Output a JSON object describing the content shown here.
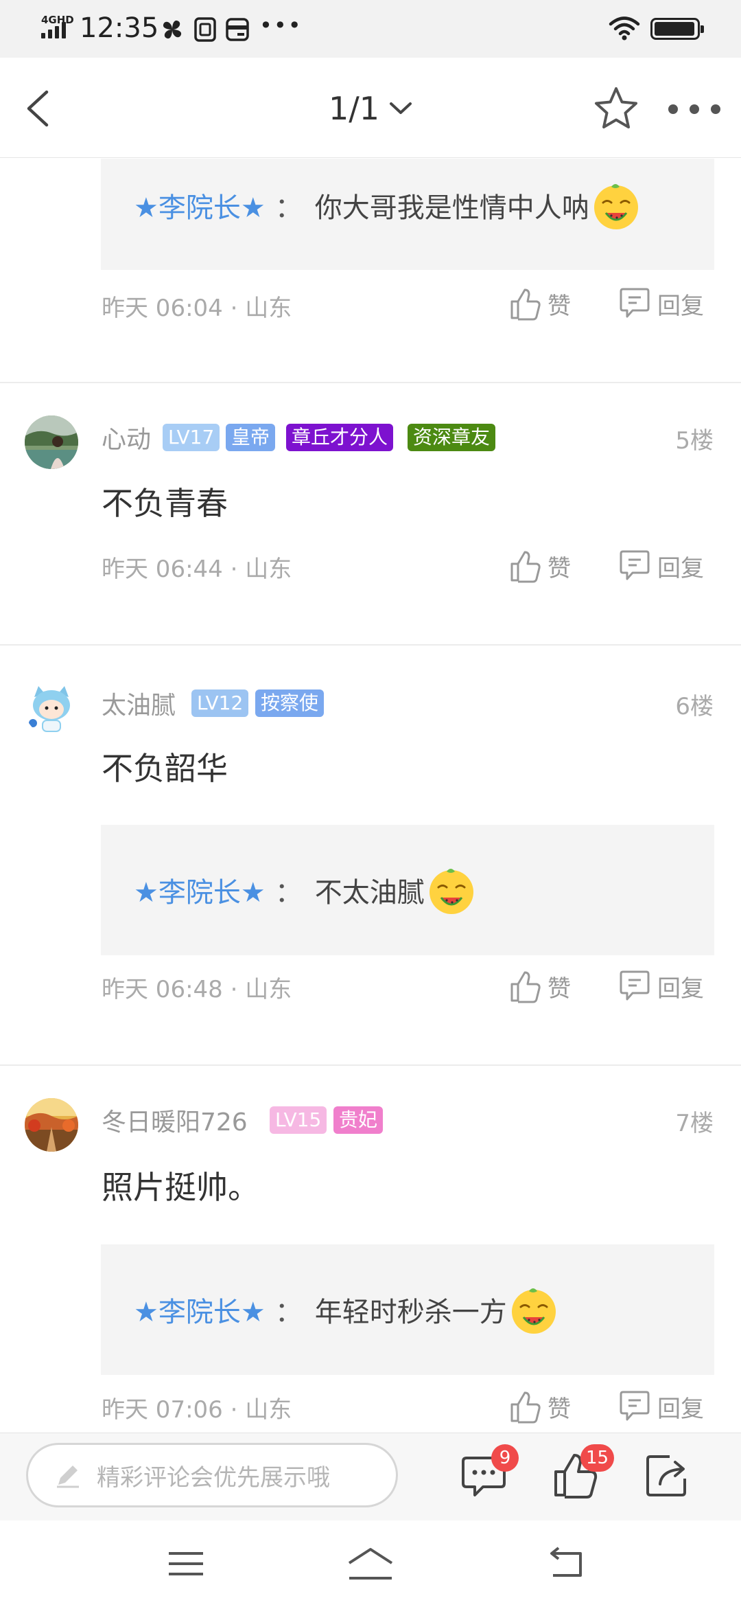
{
  "status_bar": {
    "network": "4GHD",
    "time": "12:35",
    "extra_icons": [
      "pinwheel-icon",
      "sim-icon",
      "card-icon"
    ],
    "overflow": "•••",
    "battery_level": 0.9
  },
  "header": {
    "page_indicator": "1/1",
    "icons": [
      "back-icon",
      "chevron-down-icon",
      "star-icon",
      "more-icon"
    ]
  },
  "comments": [
    {
      "partial": true,
      "reply": {
        "name": "★李院长★",
        "colon": "：",
        "text": "你大哥我是性情中人呐"
      },
      "meta": "昨天 06:04 · 山东",
      "like_label": "赞",
      "reply_label": "回复"
    },
    {
      "username": "心动",
      "badges": [
        {
          "text": "LV17",
          "color": "#a8cdf5"
        },
        {
          "text": "皇帝",
          "color": "#7aa8ef"
        },
        {
          "text": "章丘才分人",
          "color": "#7d12cf"
        },
        {
          "text": "资深章友",
          "color": "#4c8a12"
        }
      ],
      "floor": "5楼",
      "text": "不负青春",
      "meta": "昨天 06:44 · 山东",
      "like_label": "赞",
      "reply_label": "回复"
    },
    {
      "username": "太油腻",
      "badges": [
        {
          "text": "LV12",
          "color": "#9cc4f2"
        },
        {
          "text": "按察使",
          "color": "#7aa8ef"
        }
      ],
      "floor": "6楼",
      "text": "不负韶华",
      "reply": {
        "name": "★李院长★",
        "colon": "：",
        "text": "不太油腻"
      },
      "meta": "昨天 06:48 · 山东",
      "like_label": "赞",
      "reply_label": "回复"
    },
    {
      "username": "冬日暖阳726",
      "badges": [
        {
          "text": "LV15",
          "color": "#f6b8e3"
        },
        {
          "text": "贵妃",
          "color": "#f07fcc"
        }
      ],
      "floor": "7楼",
      "text": "照片挺帅。",
      "reply": {
        "name": "★李院长★",
        "colon": "：",
        "text": "年轻时秒杀一方"
      },
      "meta": "昨天 07:06 · 山东",
      "like_label": "赞",
      "reply_label": "回复"
    }
  ],
  "bottom_bar": {
    "input_placeholder": "精彩评论会优先展示哦",
    "comment_count": "9",
    "like_count": "15"
  },
  "nav_bar": {
    "icons": [
      "menu-icon",
      "home-icon",
      "back-nav-icon"
    ]
  },
  "colors": {
    "accent_blue": "#4a90e2",
    "badge_red": "#f04a4a",
    "reply_bg": "#f4f4f4"
  }
}
